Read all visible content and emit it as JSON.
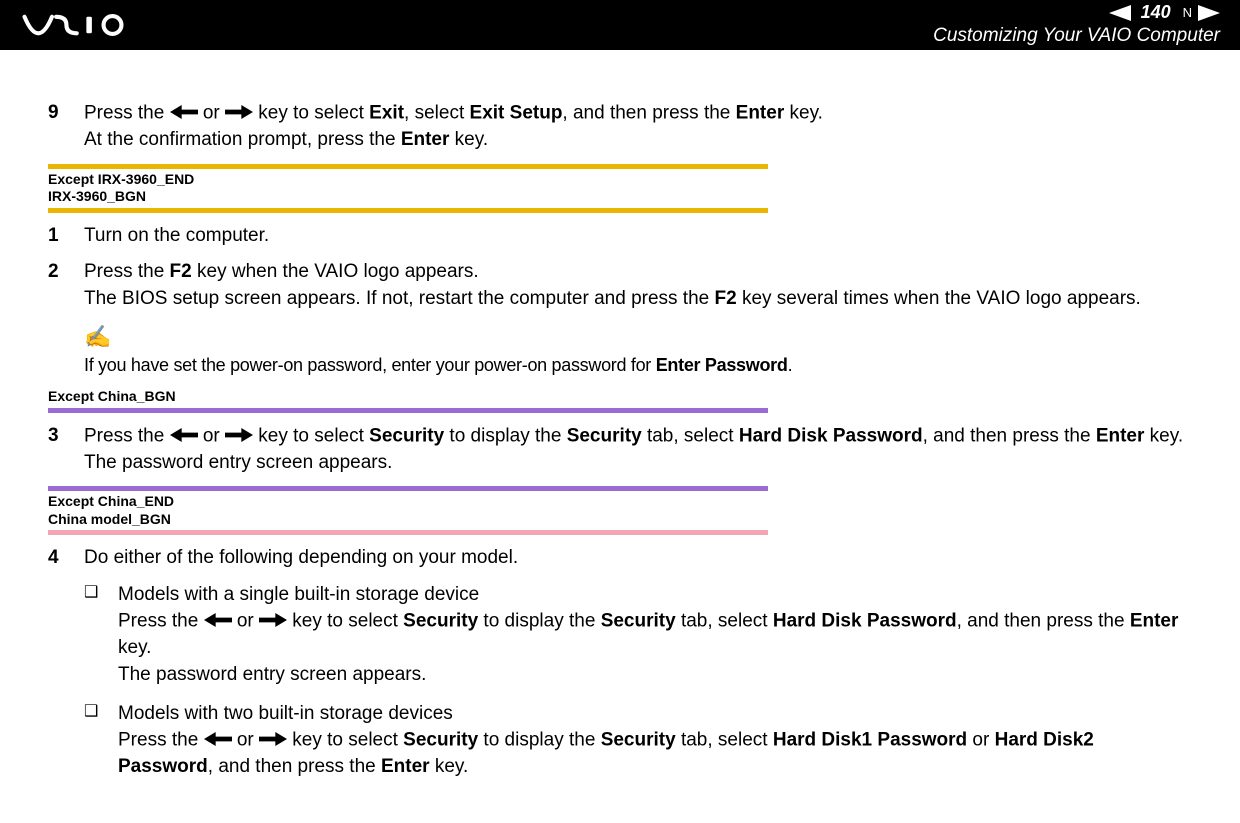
{
  "header": {
    "page_number": "140",
    "n_mark": "N",
    "section_title": "Customizing Your VAIO Computer"
  },
  "steps": {
    "s9_num": "9",
    "s9_a": "Press the ",
    "s9_b": " or ",
    "s9_c": " key to select ",
    "s9_exit": "Exit",
    "s9_d": ", select ",
    "s9_exit_setup": "Exit Setup",
    "s9_e": ", and then press the ",
    "s9_enter": "Enter",
    "s9_f": " key.",
    "s9_line2a": "At the confirmation prompt, press the ",
    "s9_line2b": " key.",
    "tag1_line1": "Except IRX-3960_END",
    "tag1_line2": "IRX-3960_BGN",
    "s1_num": "1",
    "s1_text": "Turn on the computer.",
    "s2_num": "2",
    "s2_a": "Press the ",
    "s2_f2": "F2",
    "s2_b": " key when the VAIO logo appears.",
    "s2_line2a": "The BIOS setup screen appears. If not, restart the computer and press the ",
    "s2_line2b": " key several times when the VAIO logo appears.",
    "note_icon": "✍",
    "note_a": "If you have set the power-on password, enter your power-on password for ",
    "note_enter_pw": "Enter Password",
    "note_b": ".",
    "tag2": "Except China_BGN",
    "s3_num": "3",
    "s3_a": "Press the ",
    "s3_b": " or ",
    "s3_c": " key to select ",
    "s3_sec": "Security",
    "s3_d": " to display the ",
    "s3_e": " tab, select ",
    "s3_hdp": "Hard Disk Password",
    "s3_f": ", and then press the ",
    "s3_enter": "Enter",
    "s3_g": " key.",
    "s3_line2": "The password entry screen appears.",
    "tag3_line1": "Except China_END",
    "tag3_line2": "China model_BGN",
    "s4_num": "4",
    "s4_text": "Do either of the following depending on your model.",
    "b1_title": "Models with a single built-in storage device",
    "b1_a": "Press the ",
    "b1_b": " or ",
    "b1_c": " key to select ",
    "b1_sec": "Security",
    "b1_d": " to display the ",
    "b1_e": " tab, select ",
    "b1_hdp": "Hard Disk Password",
    "b1_f": ", and then press the ",
    "b1_enter": "Enter",
    "b1_g": " key.",
    "b1_line2": "The password entry screen appears.",
    "b2_title": "Models with two built-in storage devices",
    "b2_a": "Press the ",
    "b2_b": " or ",
    "b2_c": " key to select ",
    "b2_sec": "Security",
    "b2_d": " to display the ",
    "b2_e": " tab, select ",
    "b2_hd1": "Hard Disk1 Password",
    "b2_or": " or ",
    "b2_hd2": "Hard Disk2 Password",
    "b2_f": ", and then press the ",
    "b2_enter": "Enter",
    "b2_g": " key."
  }
}
